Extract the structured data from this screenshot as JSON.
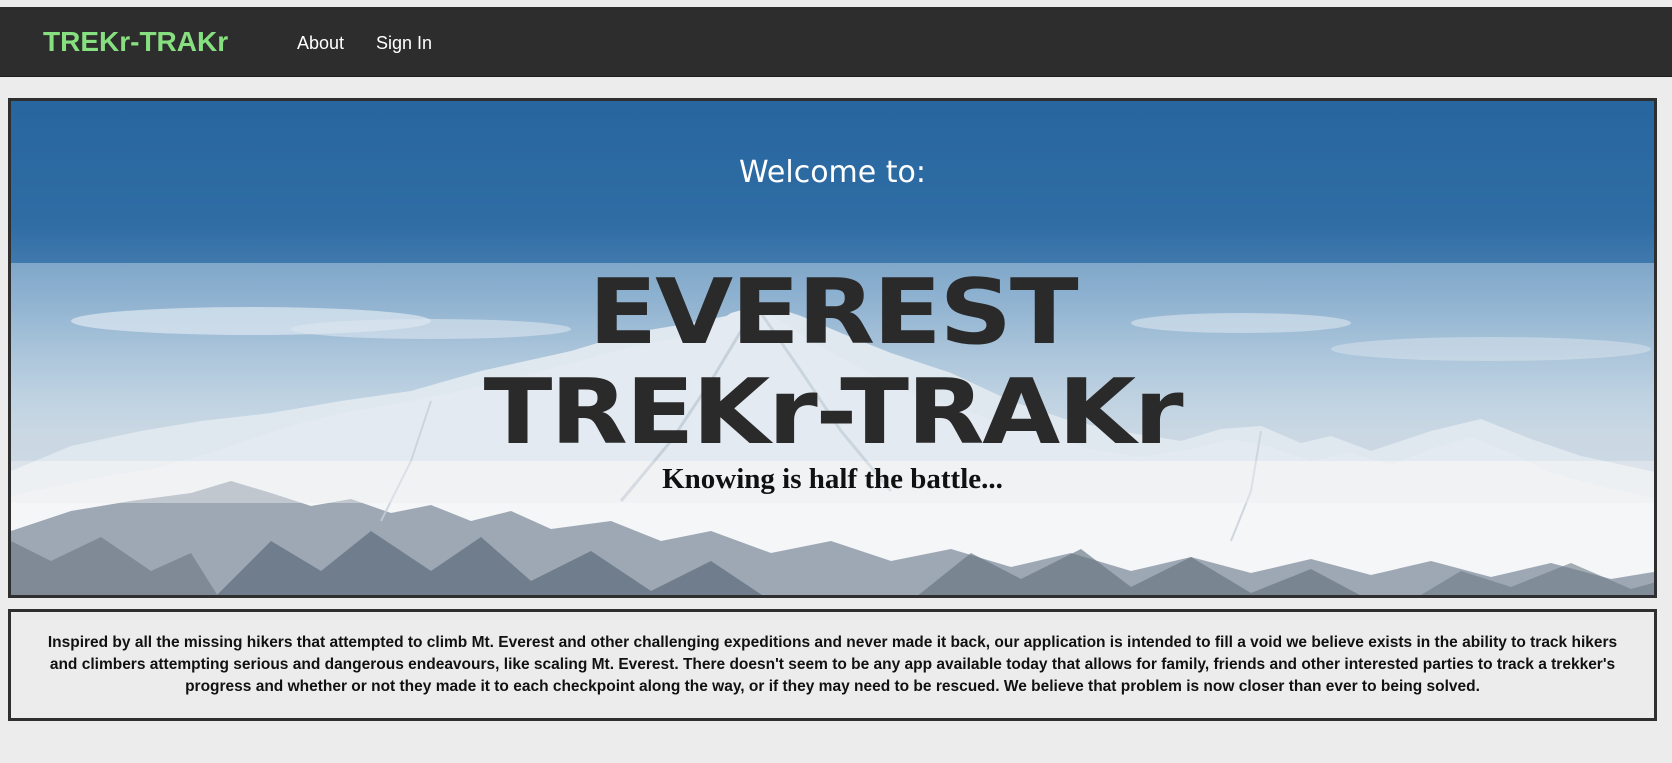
{
  "navbar": {
    "brand": "TREKr-TRAKr",
    "links": [
      {
        "label": "About"
      },
      {
        "label": "Sign In"
      }
    ],
    "brand_color": "#86e07f",
    "background": "#2d2d2d"
  },
  "hero": {
    "welcome": "Welcome to:",
    "title_line1": "EVEREST",
    "title_line2": "TREKr-TRAKr",
    "tagline": "Knowing is half the battle..."
  },
  "about": {
    "text": "Inspired by all the missing hikers that attempted to climb Mt. Everest and other challenging expeditions and never made it back, our application is intended to fill a void we believe exists in the ability to track hikers and climbers attempting serious and dangerous endeavours, like scaling Mt. Everest. There doesn't seem to be any app available today that allows for family, friends and other interested parties to track a trekker's progress and whether or not they made it to each checkpoint along the way, or if they may need to be rescued. We believe that problem is now closer than ever to being solved."
  }
}
